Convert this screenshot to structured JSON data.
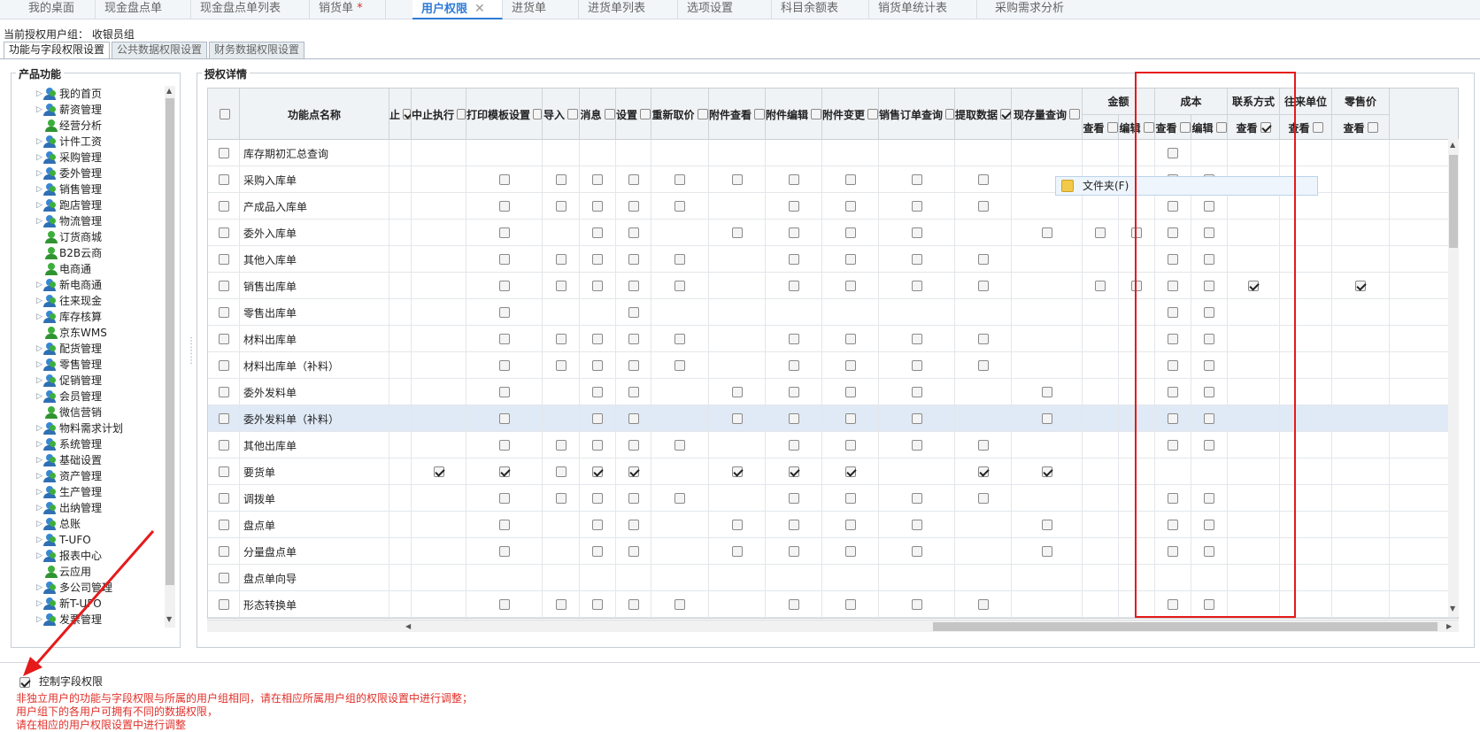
{
  "top_tabs": [
    {
      "label": "我的桌面"
    },
    {
      "label": "现金盘点单"
    },
    {
      "label": "现金盘点单列表"
    },
    {
      "label": "销货单",
      "modified": "*"
    },
    {
      "label": "用户权限",
      "active": true,
      "close": "✕"
    },
    {
      "label": "进货单"
    },
    {
      "label": "进货单列表"
    },
    {
      "label": "选项设置"
    },
    {
      "label": "科目余额表"
    },
    {
      "label": "销货单统计表"
    },
    {
      "label": "采购需求分析"
    }
  ],
  "current_group": "当前授权用户组： 收银员组",
  "sub_tabs": [
    {
      "label": "功能与字段权限设置",
      "active": true
    },
    {
      "label": "公共数据权限设置"
    },
    {
      "label": "财务数据权限设置"
    }
  ],
  "left_panel": {
    "legend": "产品功能",
    "items": [
      {
        "label": "我的首页",
        "expand": true,
        "group": true
      },
      {
        "label": "薪资管理",
        "expand": true,
        "group": true
      },
      {
        "label": "经营分析",
        "expand": false,
        "group": false
      },
      {
        "label": "计件工资",
        "expand": true,
        "group": true
      },
      {
        "label": "采购管理",
        "expand": true,
        "group": true
      },
      {
        "label": "委外管理",
        "expand": true,
        "group": true
      },
      {
        "label": "销售管理",
        "expand": true,
        "group": true
      },
      {
        "label": "跑店管理",
        "expand": true,
        "group": true
      },
      {
        "label": "物流管理",
        "expand": true,
        "group": true
      },
      {
        "label": "订货商城",
        "expand": false,
        "group": false
      },
      {
        "label": "B2B云商",
        "expand": false,
        "group": false
      },
      {
        "label": "电商通",
        "expand": false,
        "group": false
      },
      {
        "label": "新电商通",
        "expand": true,
        "group": true
      },
      {
        "label": "往来现金",
        "expand": true,
        "group": true
      },
      {
        "label": "库存核算",
        "expand": true,
        "group": true
      },
      {
        "label": "京东WMS",
        "expand": false,
        "group": false
      },
      {
        "label": "配货管理",
        "expand": true,
        "group": true
      },
      {
        "label": "零售管理",
        "expand": true,
        "group": true
      },
      {
        "label": "促销管理",
        "expand": true,
        "group": true
      },
      {
        "label": "会员管理",
        "expand": true,
        "group": true
      },
      {
        "label": "微信营销",
        "expand": false,
        "group": false
      },
      {
        "label": "物料需求计划",
        "expand": true,
        "group": true
      },
      {
        "label": "系统管理",
        "expand": true,
        "group": true
      },
      {
        "label": "基础设置",
        "expand": true,
        "group": true
      },
      {
        "label": "资产管理",
        "expand": true,
        "group": true
      },
      {
        "label": "生产管理",
        "expand": true,
        "group": true
      },
      {
        "label": "出纳管理",
        "expand": true,
        "group": true
      },
      {
        "label": "总账",
        "expand": true,
        "group": true
      },
      {
        "label": "T-UFO",
        "expand": true,
        "group": true
      },
      {
        "label": "报表中心",
        "expand": true,
        "group": true
      },
      {
        "label": "云应用",
        "expand": false,
        "group": false
      },
      {
        "label": "多公司管理",
        "expand": true,
        "group": true
      },
      {
        "label": "新T-UFO",
        "expand": true,
        "group": true
      },
      {
        "label": "发票管理",
        "expand": true,
        "group": true
      }
    ]
  },
  "right_panel": {
    "legend": "授权详情",
    "header_name": "功能点名称",
    "header_partial": "止",
    "columns": [
      {
        "label": "中止执行",
        "checked": false
      },
      {
        "label": "打印模板设置",
        "checked": false
      },
      {
        "label": "导入",
        "checked": false
      },
      {
        "label": "消息",
        "checked": false
      },
      {
        "label": "设置",
        "checked": false
      },
      {
        "label": "重新取价",
        "checked": false
      },
      {
        "label": "附件查看",
        "checked": false
      },
      {
        "label": "附件编辑",
        "checked": false
      },
      {
        "label": "附件变更",
        "checked": false
      },
      {
        "label": "销售订单查询",
        "checked": false
      },
      {
        "label": "提取数据",
        "checked": true
      },
      {
        "label": "现存量查询",
        "checked": false
      }
    ],
    "group_cols": [
      {
        "label": "金额",
        "sub": [
          "查看",
          "编辑"
        ]
      },
      {
        "label": "成本",
        "sub": [
          "查看",
          "编辑"
        ]
      }
    ],
    "tail_cols": [
      {
        "label": "联系方式",
        "sub": "查看",
        "checked": true
      },
      {
        "label": "往来单位",
        "sub": "查看",
        "checked": false
      },
      {
        "label": "零售价",
        "sub": "查看",
        "checked": false
      }
    ],
    "rows": [
      {
        "name": "库存期初汇总查询",
        "p": "..........",
        "g": "..c.",
        "t": "..."
      },
      {
        "name": "采购入库单",
        "p": ".cccccccccc.",
        "g": "..cc",
        "t": "..."
      },
      {
        "name": "产成品入库单",
        "p": ".ccccc.cccc.",
        "g": "..cc",
        "t": "..."
      },
      {
        "name": "委外入库单",
        "p": ".c.cc.cccc.c",
        "g": "cccc",
        "t": "..."
      },
      {
        "name": "其他入库单",
        "p": ".ccccc.cccc.c",
        "g": "..cc",
        "t": "..."
      },
      {
        "name": "销售出库单",
        "p": ".ccccc.cccc.c",
        "g": "cccc",
        "t": "x.x"
      },
      {
        "name": "零售出库单",
        "p": ".c..c.......",
        "g": "..cc",
        "t": "..."
      },
      {
        "name": "材料出库单",
        "p": ".ccccc.cccc.c",
        "g": "..cc",
        "t": "..."
      },
      {
        "name": "材料出库单（补料）",
        "p": ".ccccc.cccc.c",
        "g": "..cc",
        "t": "..."
      },
      {
        "name": "委外发料单",
        "p": ".c.cc.cccc.c",
        "g": "..cc",
        "t": "..."
      },
      {
        "name": "委外发料单（补料）",
        "p": ".c.cc.cccc.c",
        "g": "..cc",
        "t": "...",
        "hl": true
      },
      {
        "name": "其他出库单",
        "p": ".ccccc.cccc.c",
        "g": "..cc",
        "t": "..."
      },
      {
        "name": "要货单",
        "p": "xxcxx.xxx.xx",
        "g": "....",
        "t": "..."
      },
      {
        "name": "调拨单",
        "p": ".ccccc.cccc.c",
        "g": "..cc",
        "t": "..."
      },
      {
        "name": "盘点单",
        "p": ".c.cc.cccc.c",
        "g": "..cc",
        "t": "..."
      },
      {
        "name": "分量盘点单",
        "p": ".c.cc.cccc.c",
        "g": "..cc",
        "t": "..."
      },
      {
        "name": "盘点单向导",
        "p": "............",
        "g": "....",
        "t": "..."
      },
      {
        "name": "形态转换单",
        "p": ".ccccc.cccc.c",
        "g": "..cc",
        "t": "..."
      }
    ]
  },
  "popup": {
    "label": "文件夹(F)"
  },
  "bottom": {
    "control_label": "控制字段权限",
    "control_checked": true,
    "notes": [
      "非独立用户的功能与字段权限与所属的用户组相同，请在相应所属用户组的权限设置中进行调整；",
      "用户组下的各用户可拥有不同的数据权限，",
      "请在相应的用户权限设置中进行调整"
    ]
  },
  "colors": {
    "accent": "#2e7bd6",
    "annotation": "#e51a1a",
    "note_text": "#e0302a"
  }
}
